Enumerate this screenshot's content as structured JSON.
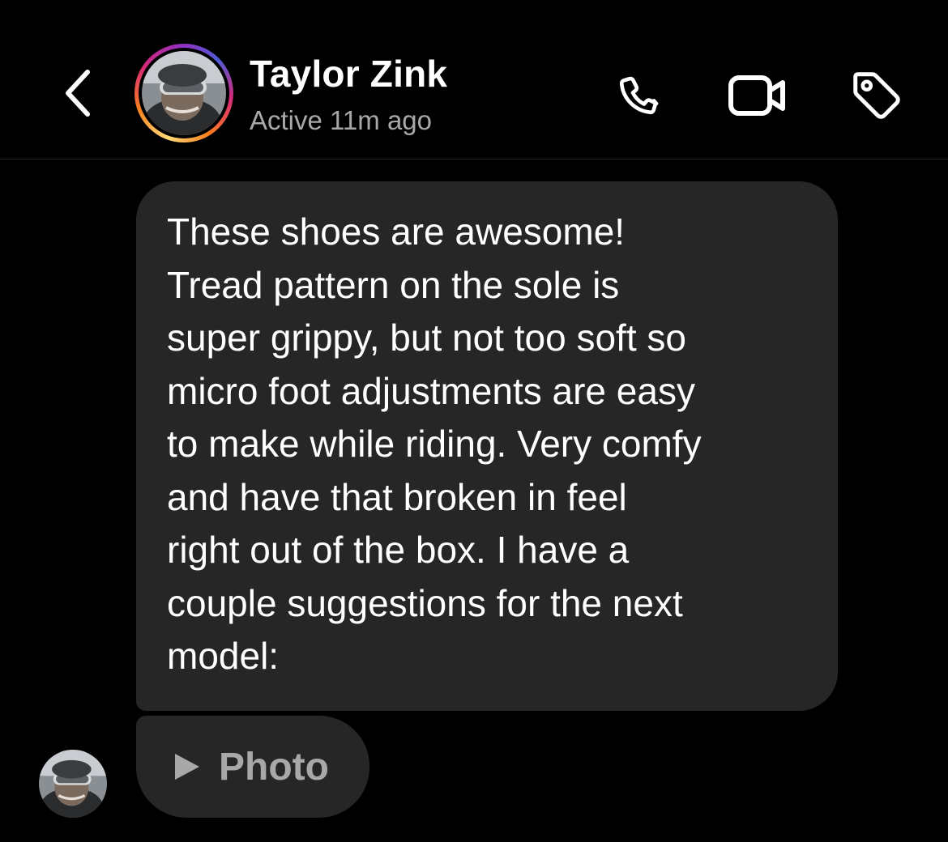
{
  "header": {
    "name": "Taylor Zink",
    "status": "Active 11m ago",
    "icons": {
      "back": "chevron-left-icon",
      "call": "phone-icon",
      "video": "video-camera-icon",
      "tag": "tag-icon"
    }
  },
  "messages": [
    {
      "type": "text",
      "text": "These shoes are awesome!\nTread pattern on the sole is\nsuper grippy, but not too soft so\nmicro foot adjustments are easy\nto make while riding. Very comfy\nand have that broken in feel\nright out of the box. I have a\ncouple suggestions for the next\nmodel:"
    },
    {
      "type": "photo",
      "label": "Photo",
      "icon": "play-icon"
    }
  ],
  "colors": {
    "background": "#000000",
    "bubble": "#262626",
    "secondary_text": "#a8a8a8",
    "divider": "#262626"
  }
}
